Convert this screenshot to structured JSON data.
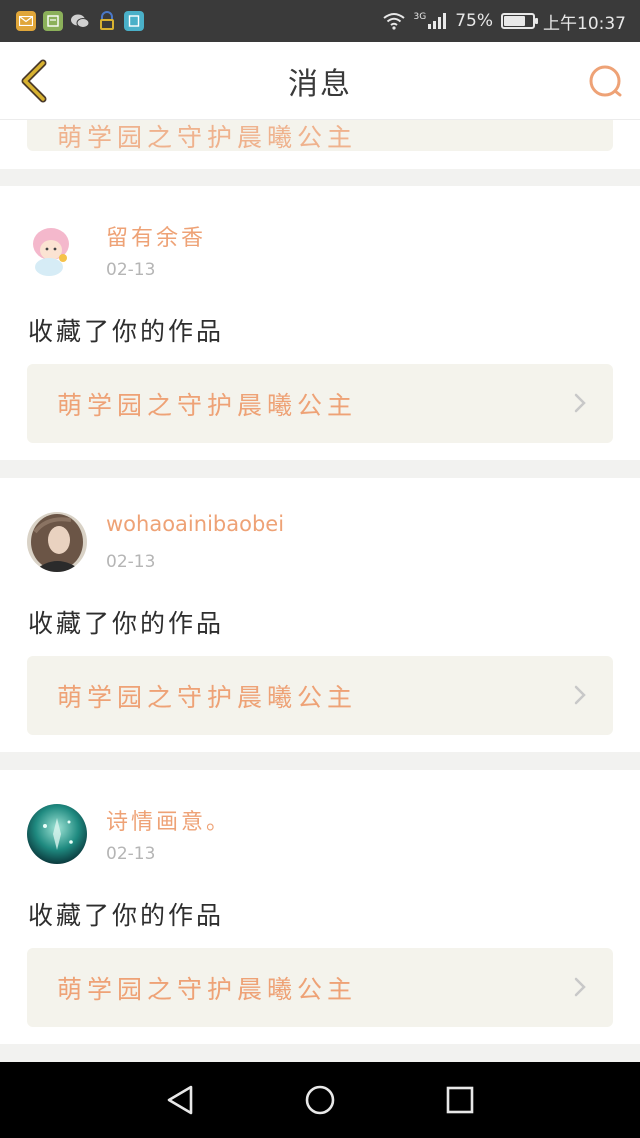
{
  "status_bar": {
    "network_type": "3G",
    "battery_percent": "75%",
    "battery_level": 0.75,
    "time": "上午10:37",
    "app_icons": [
      {
        "name": "mail-app-icon",
        "color": "#e0a63a"
      },
      {
        "name": "calendar-app-icon",
        "color": "#8bb05a"
      },
      {
        "name": "wechat-app-icon",
        "color": "#3a3a3a"
      },
      {
        "name": "lock-app-icon",
        "color": "#3a3a3a"
      },
      {
        "name": "book-app-icon",
        "color": "#4ab0c8"
      }
    ]
  },
  "header": {
    "title": "消息"
  },
  "partial": {
    "work_title": "萌学园之守护晨曦公主"
  },
  "messages": [
    {
      "username": "留有余香",
      "date": "02-13",
      "action": "收藏了你的作品",
      "work_title": "萌学园之守护晨曦公主"
    },
    {
      "username": "wohaoainibaobei",
      "date": "02-13",
      "action": "收藏了你的作品",
      "work_title": "萌学园之守护晨曦公主"
    },
    {
      "username": "诗情画意。",
      "date": "02-13",
      "action": "收藏了你的作品",
      "work_title": "萌学园之守护晨曦公主"
    }
  ],
  "colors": {
    "accent": "#eea276",
    "header_icon": "#d8b230",
    "card_bg": "#f4f3ec"
  }
}
